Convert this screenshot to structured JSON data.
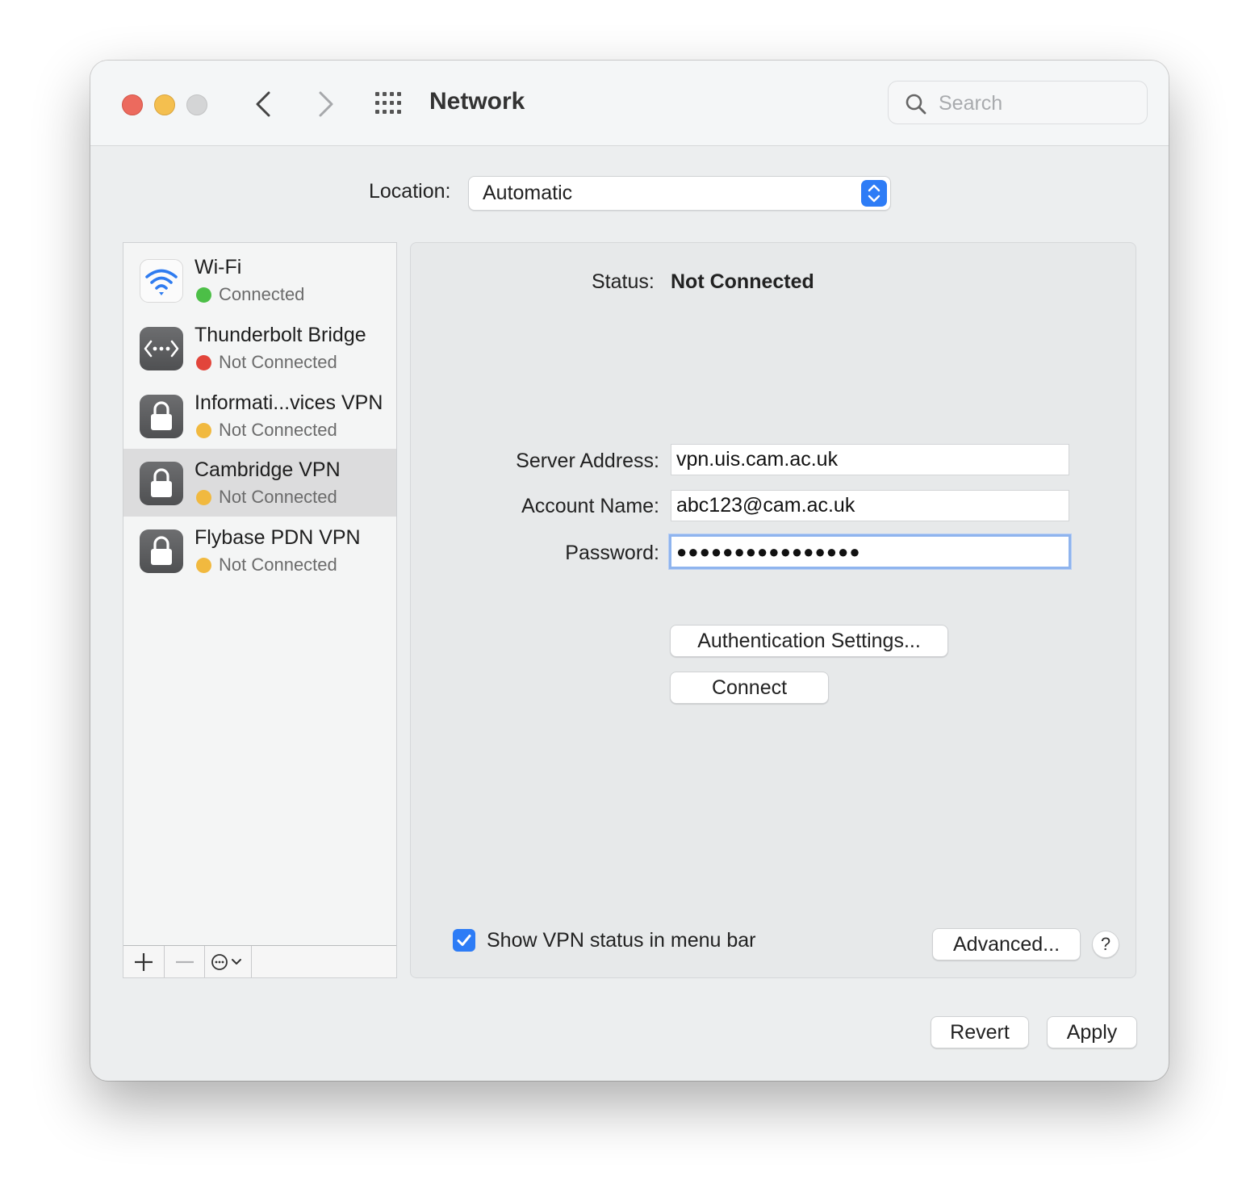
{
  "window": {
    "title": "Network",
    "search_placeholder": "Search"
  },
  "location": {
    "label": "Location:",
    "value": "Automatic"
  },
  "services": [
    {
      "name": "Wi-Fi",
      "status": "Connected",
      "status_color": "#4cbf47",
      "icon": "wifi-icon"
    },
    {
      "name": "Thunderbolt Bridge",
      "status": "Not Connected",
      "status_color": "#e2453b",
      "icon": "thunderbolt-bridge-icon"
    },
    {
      "name": "Informati...vices VPN",
      "status": "Not Connected",
      "status_color": "#f1b93f",
      "icon": "lock-icon"
    },
    {
      "name": "Cambridge VPN",
      "status": "Not Connected",
      "status_color": "#f1b93f",
      "icon": "lock-icon",
      "selected": true
    },
    {
      "name": "Flybase PDN VPN",
      "status": "Not Connected",
      "status_color": "#f1b93f",
      "icon": "lock-icon"
    }
  ],
  "detail": {
    "status_label": "Status:",
    "status_value": "Not Connected",
    "server_label": "Server Address:",
    "server_value": "vpn.uis.cam.ac.uk",
    "account_label": "Account Name:",
    "account_value": "abc123@cam.ac.uk",
    "password_label": "Password:",
    "password_value": "●●●●●●●●●●●●●●●●",
    "auth_button": "Authentication Settings...",
    "connect_button": "Connect",
    "show_status_label": "Show VPN status in menu bar",
    "show_status_checked": true,
    "advanced_button": "Advanced...",
    "help_button": "?"
  },
  "footer": {
    "revert_button": "Revert",
    "apply_button": "Apply"
  },
  "colors": {
    "accent": "#2d7cf6",
    "close": "#ec6a5e",
    "minimize": "#f4bf4f",
    "zoom": "#d4d5d6"
  }
}
